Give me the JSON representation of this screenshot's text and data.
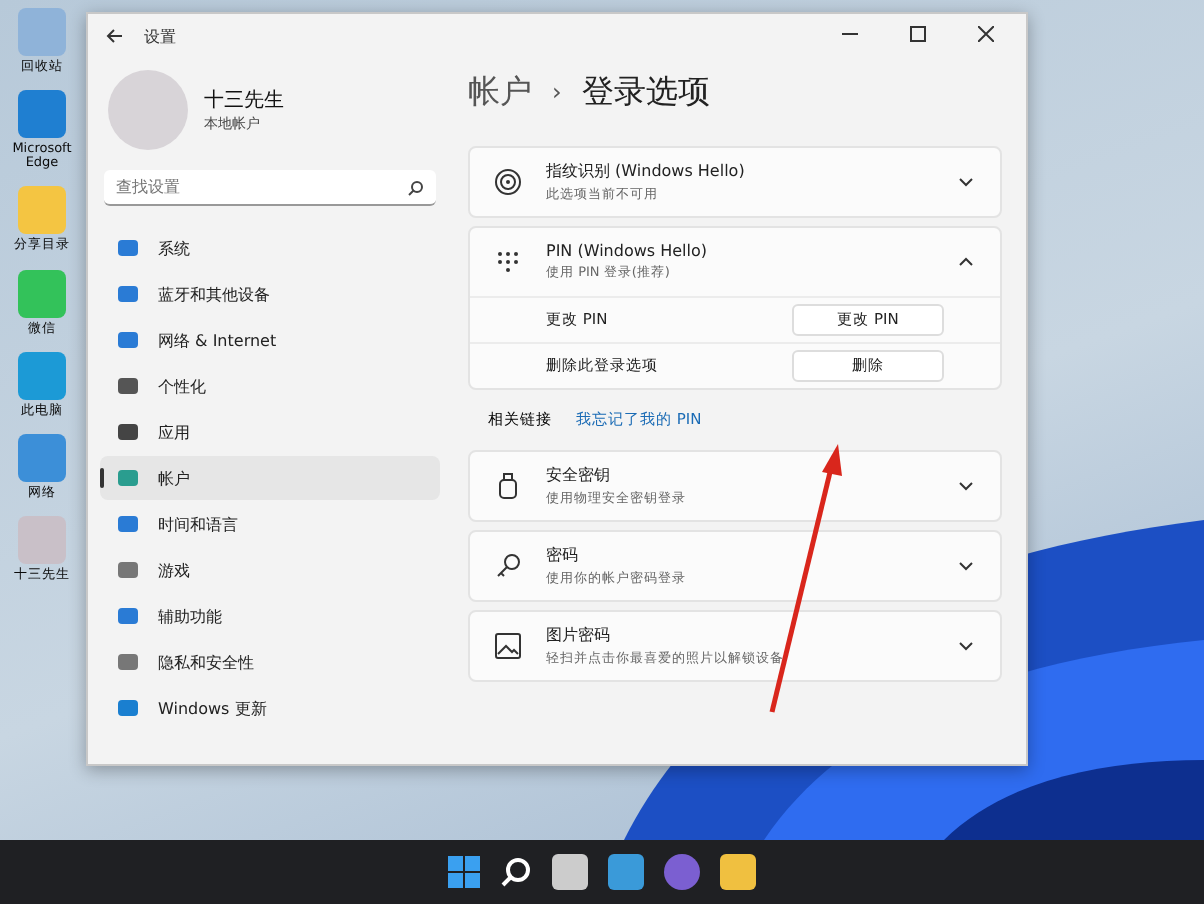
{
  "desktop_icons": [
    {
      "label": "回收站"
    },
    {
      "label": "Microsoft Edge"
    },
    {
      "label": "分享目录"
    },
    {
      "label": "微信"
    },
    {
      "label": "此电脑"
    },
    {
      "label": "网络"
    },
    {
      "label": "十三先生"
    }
  ],
  "window": {
    "title": "设置"
  },
  "user": {
    "name": "十三先生",
    "account_type": "本地帐户"
  },
  "search": {
    "placeholder": "查找设置"
  },
  "sidebar": {
    "items": [
      {
        "label": "系统",
        "selected": false
      },
      {
        "label": "蓝牙和其他设备",
        "selected": false
      },
      {
        "label": "网络 & Internet",
        "selected": false
      },
      {
        "label": "个性化",
        "selected": false
      },
      {
        "label": "应用",
        "selected": false
      },
      {
        "label": "帐户",
        "selected": true
      },
      {
        "label": "时间和语言",
        "selected": false
      },
      {
        "label": "游戏",
        "selected": false
      },
      {
        "label": "辅助功能",
        "selected": false
      },
      {
        "label": "隐私和安全性",
        "selected": false
      },
      {
        "label": "Windows 更新",
        "selected": false
      }
    ]
  },
  "breadcrumb": {
    "parent": "帐户",
    "separator": "›",
    "current": "登录选项"
  },
  "options": [
    {
      "kind": "fingerprint",
      "title": "指纹识别 (Windows Hello)",
      "subtitle": "此选项当前不可用",
      "expanded": false
    },
    {
      "kind": "pin",
      "title": "PIN (Windows Hello)",
      "subtitle": "使用 PIN 登录(推荐)",
      "expanded": true,
      "rows": [
        {
          "label": "更改 PIN",
          "button": "更改 PIN"
        },
        {
          "label": "删除此登录选项",
          "button": "删除"
        }
      ],
      "related_label": "相关链接",
      "related_link": "我忘记了我的 PIN"
    },
    {
      "kind": "key",
      "title": "安全密钥",
      "subtitle": "使用物理安全密钥登录",
      "expanded": false
    },
    {
      "kind": "password",
      "title": "密码",
      "subtitle": "使用你的帐户密码登录",
      "expanded": false
    },
    {
      "kind": "picture",
      "title": "图片密码",
      "subtitle": "轻扫并点击你最喜爱的照片以解锁设备",
      "expanded": false
    }
  ]
}
